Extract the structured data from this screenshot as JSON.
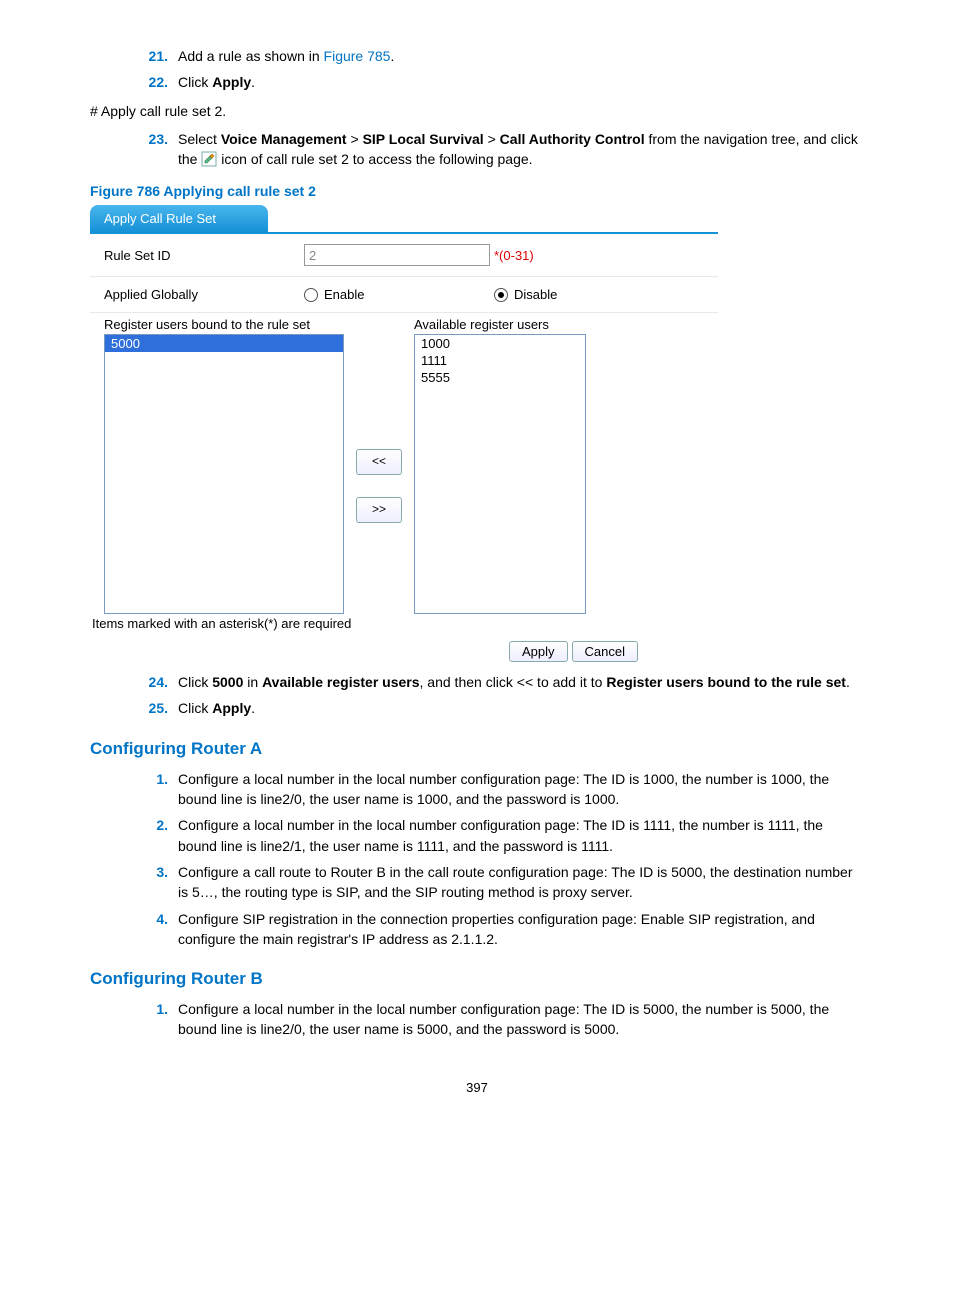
{
  "steps_a": [
    {
      "num": "21.",
      "pre": "Add a rule as shown in ",
      "link": "Figure 785",
      "post": "."
    },
    {
      "num": "22.",
      "pre": "Click ",
      "bold": "Apply",
      "post": "."
    }
  ],
  "hash_line": "# Apply call rule set 2.",
  "step23": {
    "num": "23.",
    "t1": "Select ",
    "b1": "Voice Management",
    "sep": " > ",
    "b2": "SIP Local Survival",
    "b3": "Call Authority Control",
    "t2": " from the navigation tree, and click the ",
    "t3": " icon of call rule set 2 to access the following page."
  },
  "figure_title": "Figure 786 Applying call rule set 2",
  "shot": {
    "tab": "Apply Call Rule Set",
    "row1": {
      "label": "Rule Set ID",
      "value": "2",
      "hint": "*(0-31)"
    },
    "row2": {
      "label": "Applied Globally",
      "opt1": "Enable",
      "opt2": "Disable"
    },
    "left_title": "Register users bound to the rule set",
    "left_items": [
      "5000"
    ],
    "right_title": "Available register users",
    "right_items": [
      "1000",
      "1111",
      "5555"
    ],
    "btn_left": "<<",
    "btn_right": ">>",
    "footnote": "Items marked with an asterisk(*) are required",
    "apply": "Apply",
    "cancel": "Cancel"
  },
  "step24": {
    "num": "24.",
    "t1": "Click ",
    "b1": "5000",
    "t2": " in ",
    "b2": "Available register users",
    "t3": ", and then click << to add it to ",
    "b3": "Register users bound to the rule set",
    "t4": "."
  },
  "step25": {
    "num": "25.",
    "t1": "Click ",
    "b1": "Apply",
    "t2": "."
  },
  "sec_a": "Configuring Router A",
  "router_a": [
    {
      "n": "1.",
      "t": "Configure a local number in the local number configuration page: The ID is 1000, the number is 1000, the bound line is line2/0, the user name is 1000, and the password is 1000."
    },
    {
      "n": "2.",
      "t": "Configure a local number in the local number configuration page: The ID is 1111, the number is 1111, the bound line is line2/1, the user name is 1111, and the password is 1111."
    },
    {
      "n": "3.",
      "t": "Configure a call route to Router B in the call route configuration page: The ID is 5000, the destination number is 5…, the routing type is SIP, and the SIP routing method is proxy server."
    },
    {
      "n": "4.",
      "t": "Configure SIP registration in the connection properties configuration page: Enable SIP registration, and configure the main registrar's IP address as 2.1.1.2."
    }
  ],
  "sec_b": "Configuring Router B",
  "router_b": [
    {
      "n": "1.",
      "t": "Configure a local number in the local number configuration page: The ID is 5000, the number is 5000, the bound line is line2/0, the user name is 5000, and the password is 5000."
    }
  ],
  "pagenum": "397"
}
